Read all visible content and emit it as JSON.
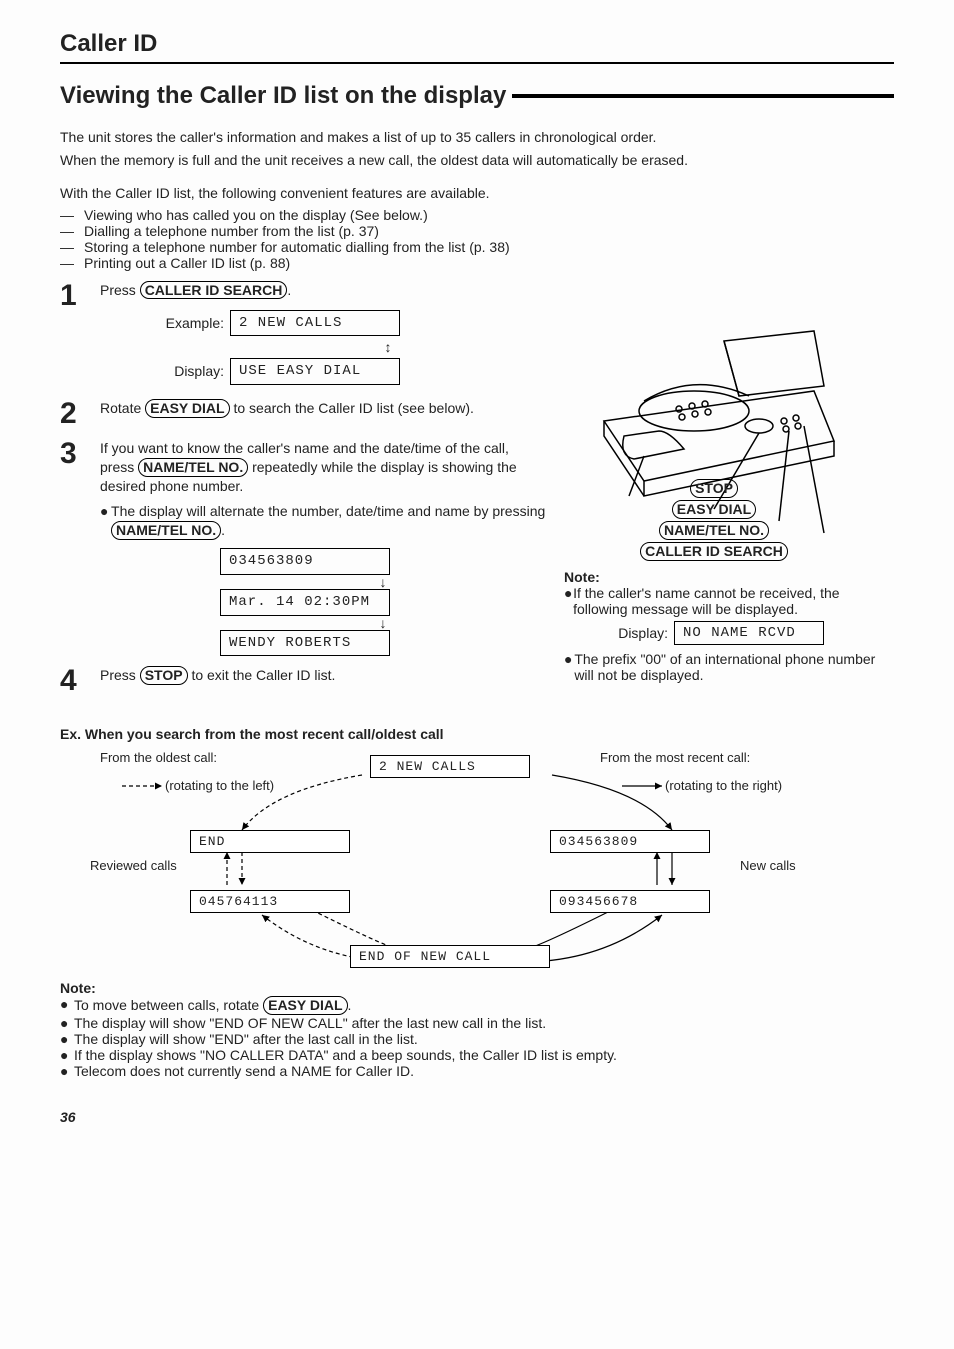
{
  "header": {
    "section": "Caller ID",
    "title": "Viewing the Caller ID list on the display"
  },
  "intro": {
    "p1": "The unit stores the caller's information and makes a list of up to 35 callers in chronological order.",
    "p2": "When the memory is full and the unit receives a new call, the oldest data will automatically be erased.",
    "p3": "With the Caller ID list, the following convenient features are available.",
    "bullets": [
      "Viewing who has called you on the display (See below.)",
      "Dialling a telephone number from the list (p. 37)",
      "Storing a telephone number for automatic dialling from the list (p. 38)",
      "Printing out a Caller ID list (p. 88)"
    ]
  },
  "steps": {
    "s1": {
      "text_a": "Press ",
      "key_a": "CALLER ID SEARCH",
      "text_b": ".",
      "ex_label": "Example:",
      "ex_value": "2 NEW CALLS",
      "disp_label": "Display:",
      "disp_value": "USE EASY DIAL"
    },
    "s2": {
      "text_a": "Rotate ",
      "key_a": "EASY DIAL",
      "text_b": " to search the Caller ID list (see below)."
    },
    "s3": {
      "text_a": "If you want to know the caller's name and the date/time of the call, press ",
      "key_a": "NAME/TEL NO.",
      "text_b": " repeatedly while the display is showing the desired phone number.",
      "sub_a": "The display will alternate the number, date/time and name by pressing ",
      "key_b": "NAME/TEL NO.",
      "sub_b": ".",
      "d1": "034563809",
      "d2": "Mar. 14 02:30PM",
      "d3": "WENDY ROBERTS"
    },
    "s4": {
      "text_a": "Press ",
      "key_a": "STOP",
      "text_b": " to exit the Caller ID list."
    }
  },
  "device_callouts": {
    "stop": "STOP",
    "easy_dial": "EASY DIAL",
    "name_tel": "NAME/TEL NO.",
    "caller_id": "CALLER ID SEARCH"
  },
  "right_note": {
    "title": "Note:",
    "b1": "If the caller's name cannot be received, the following message will be displayed.",
    "disp_label": "Display:",
    "disp_value": "NO NAME RCVD",
    "b2": "The prefix \"00\" of an international phone number will not be displayed."
  },
  "example": {
    "title": "Ex. When you search from the most recent call/oldest call",
    "from_oldest": "From the oldest call:",
    "rot_left": "(rotating to the left)",
    "from_recent": "From the most recent call:",
    "rot_right": "(rotating to the right)",
    "top": "2 NEW CALLS",
    "left_mid": "END",
    "left_bot": "045764113",
    "right_mid": "034563809",
    "right_bot": "093456678",
    "bottom": "END OF NEW CALL",
    "reviewed": "Reviewed calls",
    "newcalls": "New calls"
  },
  "notes_bottom": {
    "title": "Note:",
    "b1_a": "To move between calls, rotate ",
    "b1_key": "EASY DIAL",
    "b1_b": ".",
    "b2": "The display will show \"END OF NEW CALL\" after the last new call in the list.",
    "b3": "The display will show \"END\" after the last call in the list.",
    "b4": "If the display shows \"NO CALLER DATA\" and a beep sounds, the Caller ID list is empty.",
    "b5": "Telecom does not currently send a NAME for Caller ID."
  },
  "page_number": "36"
}
